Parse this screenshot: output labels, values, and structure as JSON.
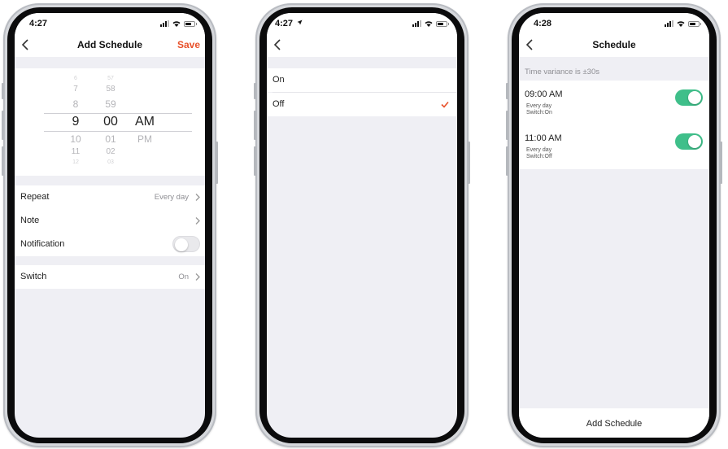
{
  "colors": {
    "accent": "#e8512a",
    "toggle_on": "#3fbf8a",
    "background": "#efeff4"
  },
  "phone1": {
    "status_time": "4:27",
    "title": "Add Schedule",
    "save_label": "Save",
    "picker": {
      "hours": [
        "6",
        "7",
        "8",
        "9",
        "10",
        "11",
        "12"
      ],
      "minutes": [
        "57",
        "58",
        "59",
        "00",
        "01",
        "02",
        "03"
      ],
      "periods": [
        "AM",
        "PM"
      ],
      "selected_hour": "9",
      "selected_minute": "00",
      "selected_period": "AM"
    },
    "rows": {
      "repeat_label": "Repeat",
      "repeat_value": "Every day",
      "note_label": "Note",
      "notification_label": "Notification",
      "notification_on": false,
      "switch_label": "Switch",
      "switch_value": "On"
    }
  },
  "phone2": {
    "status_time": "4:27",
    "options": [
      "On",
      "Off"
    ],
    "selected": "Off"
  },
  "phone3": {
    "status_time": "4:28",
    "title": "Schedule",
    "variance": "Time variance is  ±30s",
    "items": [
      {
        "time": "09:00 AM",
        "repeat": "Every day",
        "action": "Switch:On",
        "enabled": true
      },
      {
        "time": "11:00 AM",
        "repeat": "Every day",
        "action": "Switch:Off",
        "enabled": true
      }
    ],
    "add_label": "Add Schedule"
  },
  "icons": [
    "back-chevron-icon",
    "chevron-right-icon",
    "checkmark-icon",
    "signal-icon",
    "wifi-icon",
    "battery-icon",
    "location-arrow-icon"
  ]
}
